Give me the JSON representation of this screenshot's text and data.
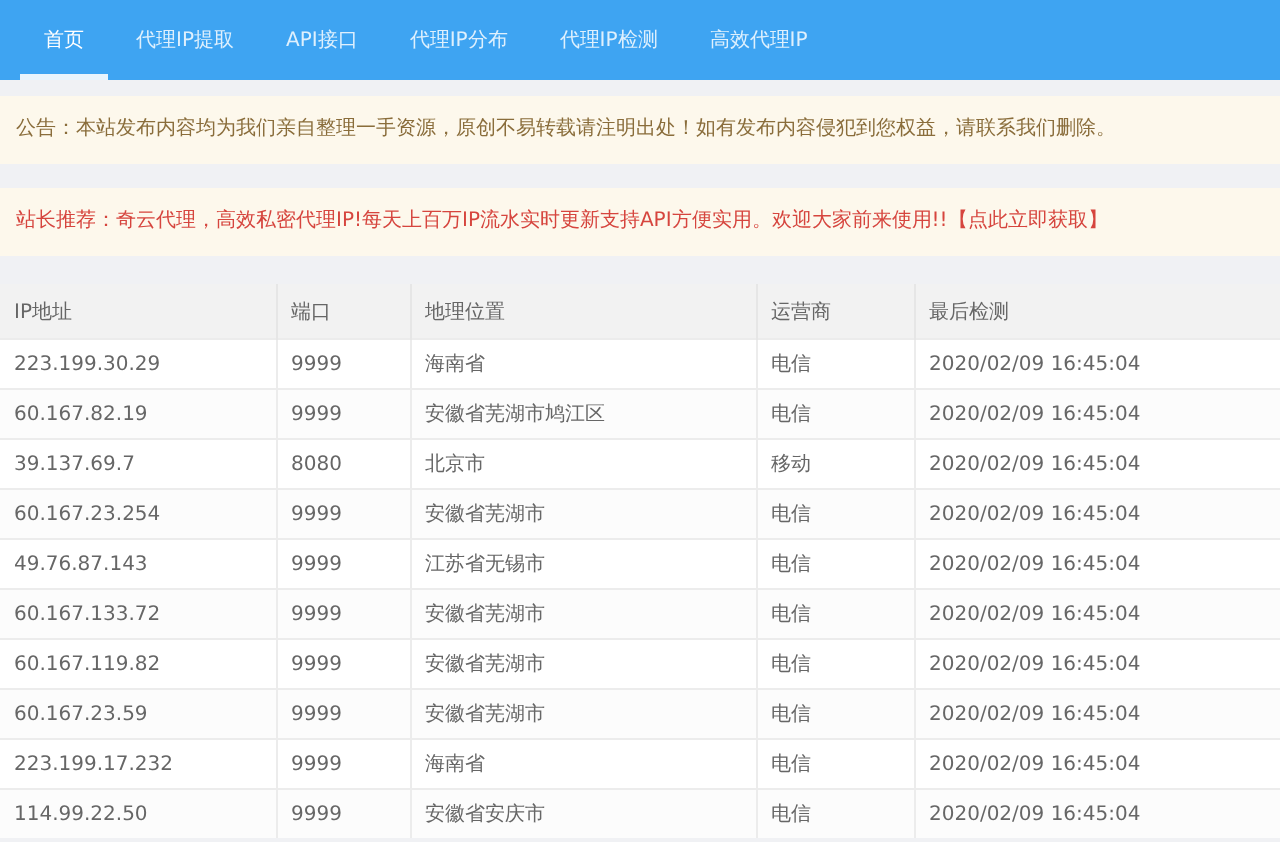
{
  "nav": {
    "tabs": [
      {
        "label": "首页",
        "selected": true
      },
      {
        "label": "代理IP提取",
        "selected": false
      },
      {
        "label": "API接口",
        "selected": false
      },
      {
        "label": "代理IP分布",
        "selected": false
      },
      {
        "label": "代理IP检测",
        "selected": false
      },
      {
        "label": "高效代理IP",
        "selected": false
      }
    ]
  },
  "notices": [
    {
      "kind": "info",
      "text": "公告：本站发布内容均为我们亲自整理一手资源，原创不易转载请注明出处！如有发布内容侵犯到您权益，请联系我们删除。"
    },
    {
      "kind": "promo",
      "text": "站长推荐：奇云代理，高效私密代理IP!每天上百万IP流水实时更新支持API方便实用。欢迎大家前来使用!!【点此立即获取】"
    }
  ],
  "table": {
    "columns": [
      "IP地址",
      "端口",
      "地理位置",
      "运营商",
      "最后检测"
    ],
    "rows": [
      [
        "223.199.30.29",
        "9999",
        "海南省",
        "电信",
        "2020/02/09 16:45:04"
      ],
      [
        "60.167.82.19",
        "9999",
        "安徽省芜湖市鸠江区",
        "电信",
        "2020/02/09 16:45:04"
      ],
      [
        "39.137.69.7",
        "8080",
        "北京市",
        "移动",
        "2020/02/09 16:45:04"
      ],
      [
        "60.167.23.254",
        "9999",
        "安徽省芜湖市",
        "电信",
        "2020/02/09 16:45:04"
      ],
      [
        "49.76.87.143",
        "9999",
        "江苏省无锡市",
        "电信",
        "2020/02/09 16:45:04"
      ],
      [
        "60.167.133.72",
        "9999",
        "安徽省芜湖市",
        "电信",
        "2020/02/09 16:45:04"
      ],
      [
        "60.167.119.82",
        "9999",
        "安徽省芜湖市",
        "电信",
        "2020/02/09 16:45:04"
      ],
      [
        "60.167.23.59",
        "9999",
        "安徽省芜湖市",
        "电信",
        "2020/02/09 16:45:04"
      ],
      [
        "223.199.17.232",
        "9999",
        "海南省",
        "电信",
        "2020/02/09 16:45:04"
      ],
      [
        "114.99.22.50",
        "9999",
        "安徽省安庆市",
        "电信",
        "2020/02/09 16:45:04"
      ]
    ]
  }
}
